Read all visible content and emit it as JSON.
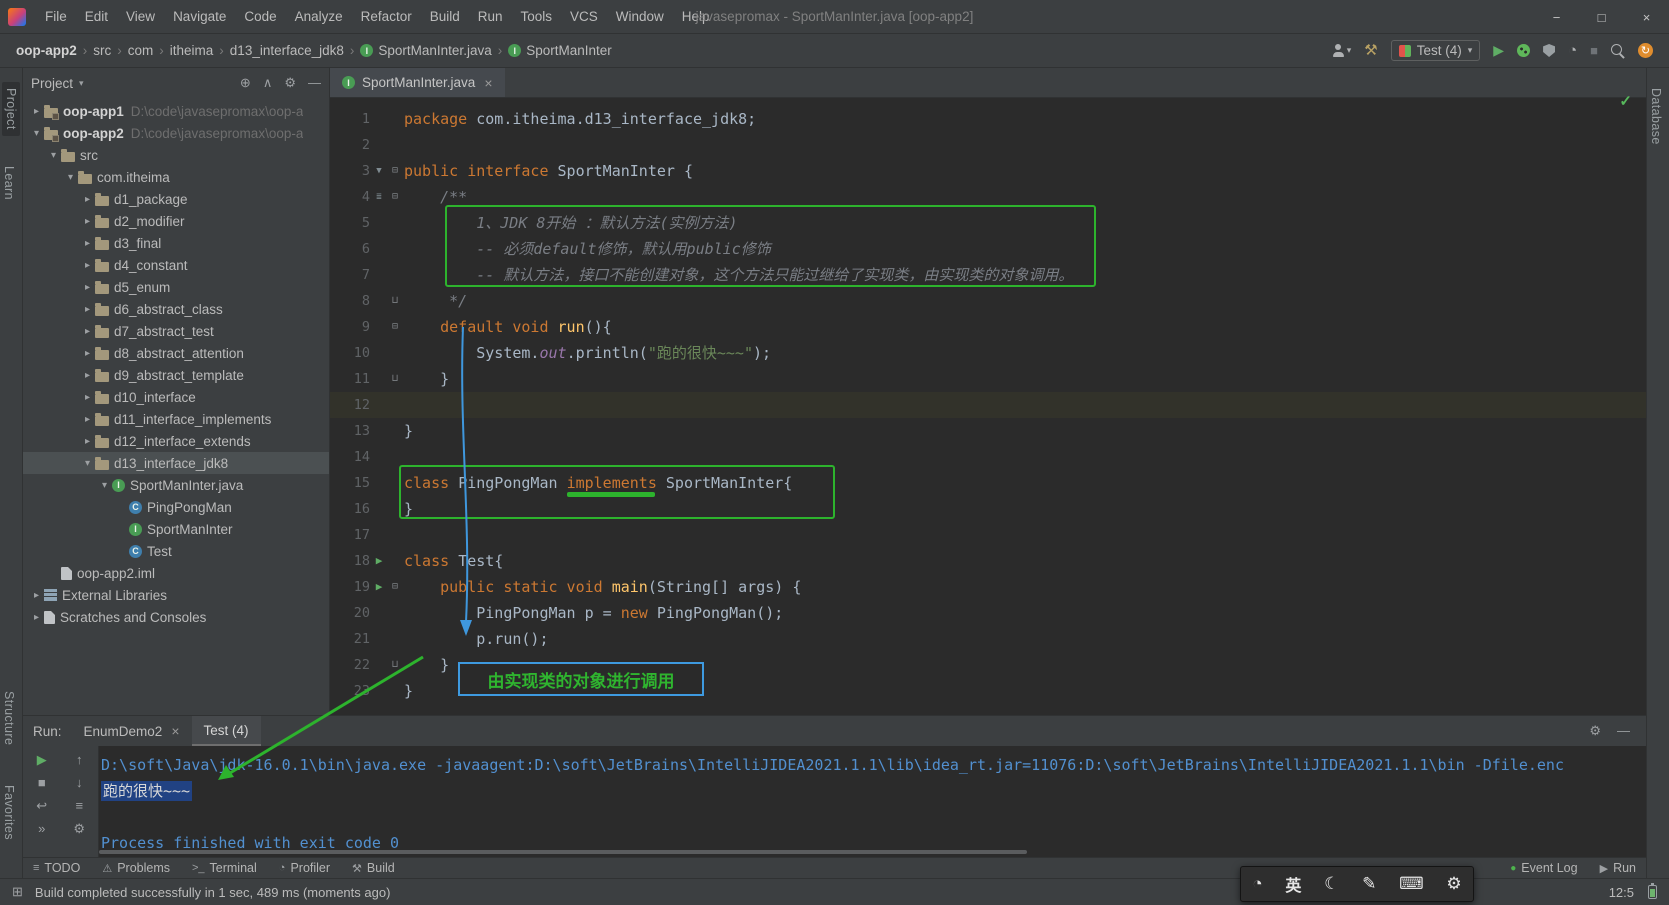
{
  "window": {
    "title": "javasepromax - SportManInter.java [oop-app2]"
  },
  "menu": [
    "File",
    "Edit",
    "View",
    "Navigate",
    "Code",
    "Analyze",
    "Refactor",
    "Build",
    "Run",
    "Tools",
    "VCS",
    "Window",
    "Help"
  ],
  "breadcrumbs": [
    {
      "label": "oop-app2",
      "bold": true
    },
    {
      "label": "src"
    },
    {
      "label": "com"
    },
    {
      "label": "itheima"
    },
    {
      "label": "d13_interface_jdk8"
    },
    {
      "label": "SportManInter.java",
      "icon": "interface"
    },
    {
      "label": "SportManInter",
      "icon": "interface"
    }
  ],
  "toolbar": {
    "run_config": "Test (4)"
  },
  "strips": {
    "project": "Project",
    "learn": "Learn",
    "structure": "Structure",
    "favorites": "Favorites",
    "database": "Database"
  },
  "project_panel": {
    "title": "Project",
    "items": [
      {
        "label": "oop-app1",
        "path": "D:\\code\\javasepromax\\oop-a",
        "icon": "module",
        "indent": 0,
        "chevron": "right",
        "bold": true
      },
      {
        "label": "oop-app2",
        "path": "D:\\code\\javasepromax\\oop-a",
        "icon": "module",
        "indent": 0,
        "chevron": "down",
        "bold": true
      },
      {
        "label": "src",
        "icon": "folder",
        "indent": 1,
        "chevron": "down"
      },
      {
        "label": "com.itheima",
        "icon": "folder",
        "indent": 2,
        "chevron": "down"
      },
      {
        "label": "d1_package",
        "icon": "folder",
        "indent": 3,
        "chevron": "right"
      },
      {
        "label": "d2_modifier",
        "icon": "folder",
        "indent": 3,
        "chevron": "right"
      },
      {
        "label": "d3_final",
        "icon": "folder",
        "indent": 3,
        "chevron": "right"
      },
      {
        "label": "d4_constant",
        "icon": "folder",
        "indent": 3,
        "chevron": "right"
      },
      {
        "label": "d5_enum",
        "icon": "folder",
        "indent": 3,
        "chevron": "right"
      },
      {
        "label": "d6_abstract_class",
        "icon": "folder",
        "indent": 3,
        "chevron": "right"
      },
      {
        "label": "d7_abstract_test",
        "icon": "folder",
        "indent": 3,
        "chevron": "right"
      },
      {
        "label": "d8_abstract_attention",
        "icon": "folder",
        "indent": 3,
        "chevron": "right"
      },
      {
        "label": "d9_abstract_template",
        "icon": "folder",
        "indent": 3,
        "chevron": "right"
      },
      {
        "label": "d10_interface",
        "icon": "folder",
        "indent": 3,
        "chevron": "right"
      },
      {
        "label": "d11_interface_implements",
        "icon": "folder",
        "indent": 3,
        "chevron": "right"
      },
      {
        "label": "d12_interface_extends",
        "icon": "folder",
        "indent": 3,
        "chevron": "right"
      },
      {
        "label": "d13_interface_jdk8",
        "icon": "folder",
        "indent": 3,
        "chevron": "down",
        "selected": true
      },
      {
        "label": "SportManInter.java",
        "icon": "interface",
        "indent": 4,
        "chevron": "down"
      },
      {
        "label": "PingPongMan",
        "icon": "class",
        "indent": 5
      },
      {
        "label": "SportManInter",
        "icon": "interface",
        "indent": 5
      },
      {
        "label": "Test",
        "icon": "class",
        "indent": 5
      },
      {
        "label": "oop-app2.iml",
        "icon": "file",
        "indent": 1
      },
      {
        "label": "External Libraries",
        "icon": "library",
        "indent": 0,
        "chevron": "right"
      },
      {
        "label": "Scratches and Consoles",
        "icon": "file",
        "indent": 0,
        "chevron": "right"
      }
    ]
  },
  "editor": {
    "tab": "SportManInter.java",
    "annotations": {
      "callout": "由实现类的对象进行调用"
    },
    "lines": [
      {
        "n": 1,
        "seg": [
          [
            "package ",
            "kw"
          ],
          [
            "com.itheima.d13_interface_jdk8;",
            "pl"
          ]
        ]
      },
      {
        "n": 2,
        "seg": []
      },
      {
        "n": 3,
        "seg": [
          [
            "public interface ",
            "kw"
          ],
          [
            "SportManInter {",
            "pl"
          ]
        ],
        "g": "impl",
        "fold": "minus"
      },
      {
        "n": 4,
        "seg": [
          [
            "    /**",
            "cm"
          ]
        ],
        "g": "annotate",
        "fold": "minus"
      },
      {
        "n": 5,
        "seg": [
          [
            "        1、JDK 8开始 ：默认方法(实例方法)",
            "cm"
          ]
        ]
      },
      {
        "n": 6,
        "seg": [
          [
            "        -- 必须default修饰，默认用public修饰",
            "cm"
          ]
        ]
      },
      {
        "n": 7,
        "seg": [
          [
            "        -- 默认方法，接口不能创建对象，这个方法只能过继给了实现类，由实现类的对象调用。",
            "cm"
          ]
        ]
      },
      {
        "n": 8,
        "seg": [
          [
            "     */",
            "cm"
          ]
        ],
        "fold": "end"
      },
      {
        "n": 9,
        "seg": [
          [
            "    ",
            "pl"
          ],
          [
            "default void ",
            "kw"
          ],
          [
            "run",
            "fn"
          ],
          [
            "(){",
            "pl"
          ]
        ],
        "fold": "minus"
      },
      {
        "n": 10,
        "seg": [
          [
            "        System.",
            "pl"
          ],
          [
            "out",
            "field"
          ],
          [
            ".println(",
            "pl"
          ],
          [
            "\"跑的很快~~~\"",
            "str"
          ],
          [
            ");",
            "pl"
          ]
        ]
      },
      {
        "n": 11,
        "seg": [
          [
            "    }",
            "pl"
          ]
        ],
        "fold": "end"
      },
      {
        "n": 12,
        "seg": [],
        "caret": true
      },
      {
        "n": 13,
        "seg": [
          [
            "}",
            "pl"
          ]
        ]
      },
      {
        "n": 14,
        "seg": []
      },
      {
        "n": 15,
        "seg": [
          [
            "class ",
            "kw"
          ],
          [
            "PingPongMan ",
            "pl"
          ],
          [
            "implements",
            "kw impl"
          ],
          [
            " SportManInter{",
            "pl"
          ]
        ]
      },
      {
        "n": 16,
        "seg": [
          [
            "}",
            "pl"
          ]
        ]
      },
      {
        "n": 17,
        "seg": []
      },
      {
        "n": 18,
        "seg": [
          [
            "class ",
            "kw"
          ],
          [
            "Test{",
            "pl"
          ]
        ],
        "run": true
      },
      {
        "n": 19,
        "seg": [
          [
            "    ",
            "pl"
          ],
          [
            "public static void ",
            "kw"
          ],
          [
            "main",
            "fn"
          ],
          [
            "(String[] args) {",
            "pl"
          ]
        ],
        "run": true,
        "fold": "minus"
      },
      {
        "n": 20,
        "seg": [
          [
            "        PingPongMan p = ",
            "pl"
          ],
          [
            "new ",
            "kw"
          ],
          [
            "PingPongMan();",
            "pl"
          ]
        ]
      },
      {
        "n": 21,
        "seg": [
          [
            "        p.run();",
            "pl"
          ]
        ]
      },
      {
        "n": 22,
        "seg": [
          [
            "    }",
            "pl"
          ]
        ],
        "fold": "end"
      },
      {
        "n": 23,
        "seg": [
          [
            "}",
            "pl"
          ]
        ]
      }
    ]
  },
  "run_panel": {
    "label": "Run:",
    "tabs": [
      {
        "label": "EnumDemo2",
        "closable": true
      },
      {
        "label": "Test (4)",
        "active": true
      }
    ],
    "tools": [
      {
        "name": "rerun-button",
        "icon": "rerun",
        "green": true
      },
      {
        "name": "nav-up-button",
        "icon": "nav_up"
      },
      {
        "name": "stop-button",
        "icon": "stop"
      },
      {
        "name": "nav-down-button",
        "icon": "nav_down"
      },
      {
        "name": "soft-wrap-button",
        "icon": "wrap"
      },
      {
        "name": "scroll-to-end-button",
        "icon": "list"
      },
      {
        "name": "more-options-button",
        "icon": "more"
      },
      {
        "name": "console-settings-button",
        "icon": "settings"
      }
    ],
    "console": [
      {
        "text": "D:\\soft\\Java\\jdk-16.0.1\\bin\\java.exe -javaagent:D:\\soft\\JetBrains\\IntelliJIDEA2021.1.1\\lib\\idea_rt.jar=11076:D:\\soft\\JetBrains\\IntelliJIDEA2021.1.1\\bin -Dfile.enc",
        "cls": "cmd"
      },
      {
        "text": "跑的很快~~~",
        "cls": "sel"
      },
      {
        "text": "",
        "cls": "cmd"
      },
      {
        "text": "Process finished with exit code 0",
        "cls": "cmd"
      }
    ]
  },
  "bottom_bar": {
    "left": [
      {
        "label": "TODO",
        "icon": "list"
      },
      {
        "label": "Problems",
        "icon": "warning"
      },
      {
        "label": "Terminal",
        "icon": "terminal"
      },
      {
        "label": "Profiler",
        "icon": "gauge"
      },
      {
        "label": "Build",
        "icon": "hammer"
      }
    ],
    "right": [
      {
        "label": "Event Log",
        "icon": "event_dot"
      },
      {
        "label": "Run",
        "icon": "run"
      }
    ]
  },
  "status_bar": {
    "message": "Build completed successfully in 1 sec, 489 ms (moments ago)",
    "caret_position": "12:5"
  },
  "ime": {
    "lang": "英"
  },
  "icons": {
    "locate": "⊕",
    "collapse_all": "∧",
    "settings": "⚙",
    "hide": "—",
    "chevron_down": "▾",
    "chevron_right": "▸",
    "close": "×",
    "run": "▶",
    "rerun": "▶",
    "stop": "■",
    "nav_up": "↑",
    "nav_down": "↓",
    "wrap": "↩",
    "list": "≡",
    "more": "»",
    "hammer": "⚒",
    "gauge": "◔",
    "update": "↻",
    "check": "✓",
    "moon": "☾",
    "pen": "✎",
    "keyboard": "⌨",
    "ime_status": "◔",
    "grid": "⊞",
    "warning": "⚠",
    "event_dot": "●",
    "fold_minus": "⊟",
    "fold_end": "⊔",
    "impl_marker": "▼",
    "annotate": "≣",
    "minimize": "−",
    "maximize": "□",
    "terminal": ">_"
  },
  "colors": {
    "accent_green": "#2db32d",
    "accent_blue": "#3f97dd",
    "selection_blue": "#214283",
    "console_text": "#5290d0"
  }
}
